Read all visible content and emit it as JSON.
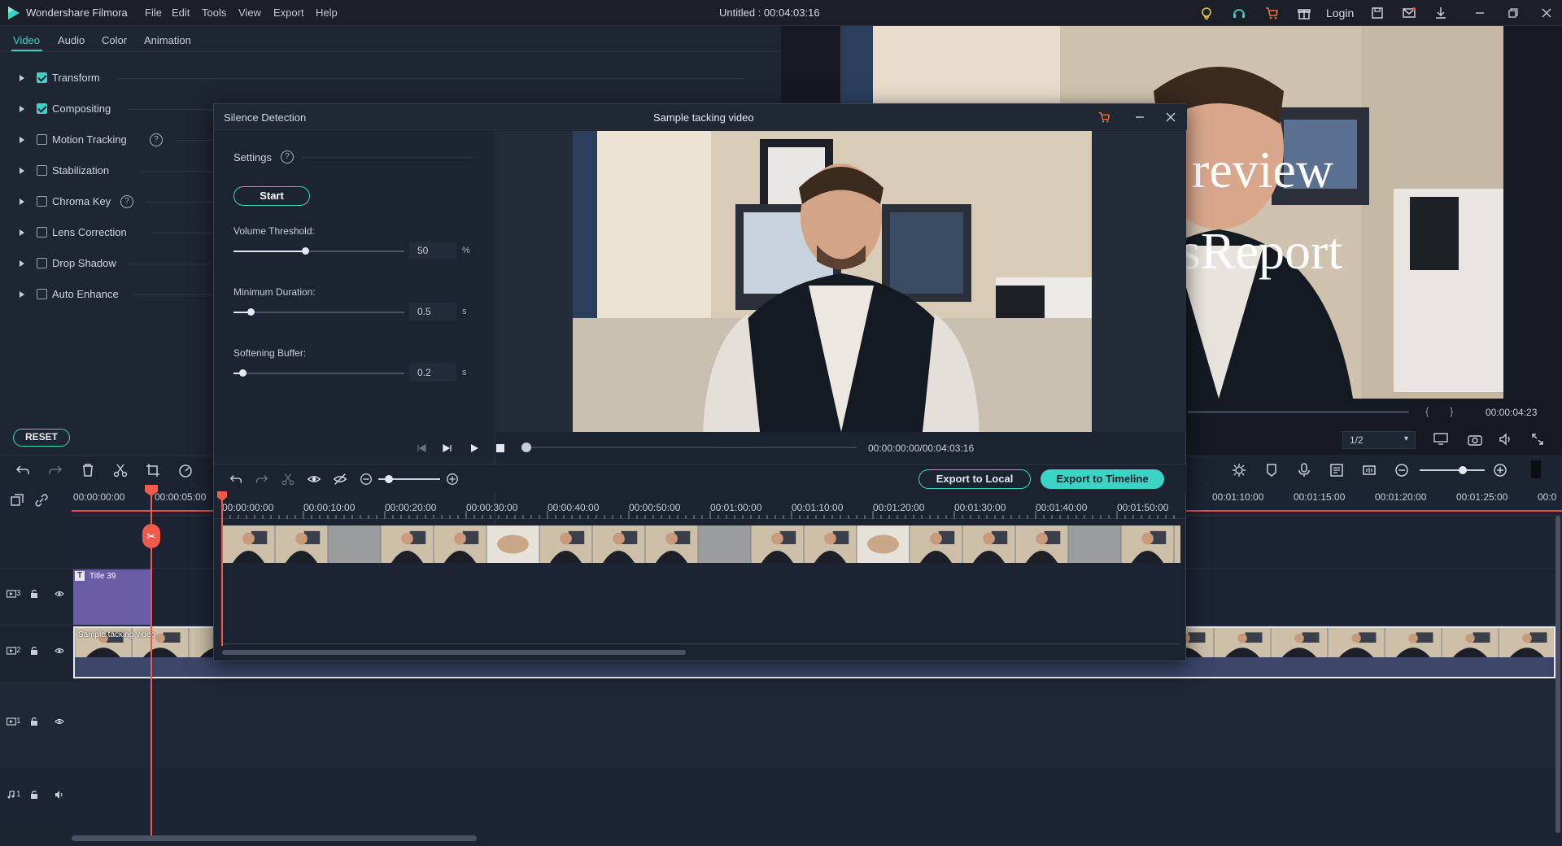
{
  "app": {
    "name": "Wondershare Filmora",
    "menu": [
      "File",
      "Edit",
      "Tools",
      "View",
      "Export",
      "Help"
    ],
    "document_title": "Untitled : 00:04:03:16",
    "login_label": "Login"
  },
  "property_panel": {
    "tabs": [
      "Video",
      "Audio",
      "Color",
      "Animation"
    ],
    "active_tab": "Video",
    "items": [
      {
        "label": "Transform",
        "checked": true,
        "help": false
      },
      {
        "label": "Compositing",
        "checked": true,
        "help": false
      },
      {
        "label": "Motion Tracking",
        "checked": false,
        "help": true
      },
      {
        "label": "Stabilization",
        "checked": false,
        "help": false
      },
      {
        "label": "Chroma Key",
        "checked": false,
        "help": true
      },
      {
        "label": "Lens Correction",
        "checked": false,
        "help": false
      },
      {
        "label": "Drop Shadow",
        "checked": false,
        "help": false
      },
      {
        "label": "Auto Enhance",
        "checked": false,
        "help": false
      }
    ],
    "reset_label": "RESET",
    "help_glyph": "?"
  },
  "preview": {
    "overlay_line1": "review",
    "overlay_line2": "vsReport",
    "timecode": "00:00:04:23",
    "ratio": "1/2",
    "brace_open": "{",
    "brace_close": "}"
  },
  "dialog": {
    "name": "Silence Detection",
    "clip_title": "Sample tacking video",
    "settings_label": "Settings",
    "start_label": "Start",
    "params": [
      {
        "label": "Volume Threshold:",
        "value": "50",
        "unit": "%",
        "fraction": 0.42
      },
      {
        "label": "Minimum Duration:",
        "value": "0.5",
        "unit": "s",
        "fraction": 0.1
      },
      {
        "label": "Softening Buffer:",
        "value": "0.2",
        "unit": "s",
        "fraction": 0.05
      }
    ],
    "playback_timecode": "00:00:00:00/00:04:03:16",
    "export_local_label": "Export to Local",
    "export_timeline_label": "Export to Timeline",
    "ruler": [
      "00:00:00:00",
      "00:00:10:00",
      "00:00:20:00",
      "00:00:30:00",
      "00:00:40:00",
      "00:00:50:00",
      "00:01:00:00",
      "00:01:10:00",
      "00:01:20:00",
      "00:01:30:00",
      "00:01:40:00",
      "00:01:50:00"
    ]
  },
  "timeline": {
    "ruler_left": [
      "00:00:00:00",
      "00:00:05:00"
    ],
    "ruler_right": [
      "00:01:10:00",
      "00:01:15:00",
      "00:01:20:00",
      "00:01:25:00",
      "00:0"
    ],
    "tracks": [
      {
        "id": "3",
        "kind": "video"
      },
      {
        "id": "2",
        "kind": "video"
      },
      {
        "id": "1",
        "kind": "video"
      },
      {
        "id": "1",
        "kind": "audio"
      }
    ],
    "title_clip_label": "Title 39",
    "video_clip_label": "Sample tacking video"
  },
  "colors": {
    "accent": "#3cd3c6",
    "playhead": "#f05a4a",
    "title_clip": "#6a5ba6"
  }
}
